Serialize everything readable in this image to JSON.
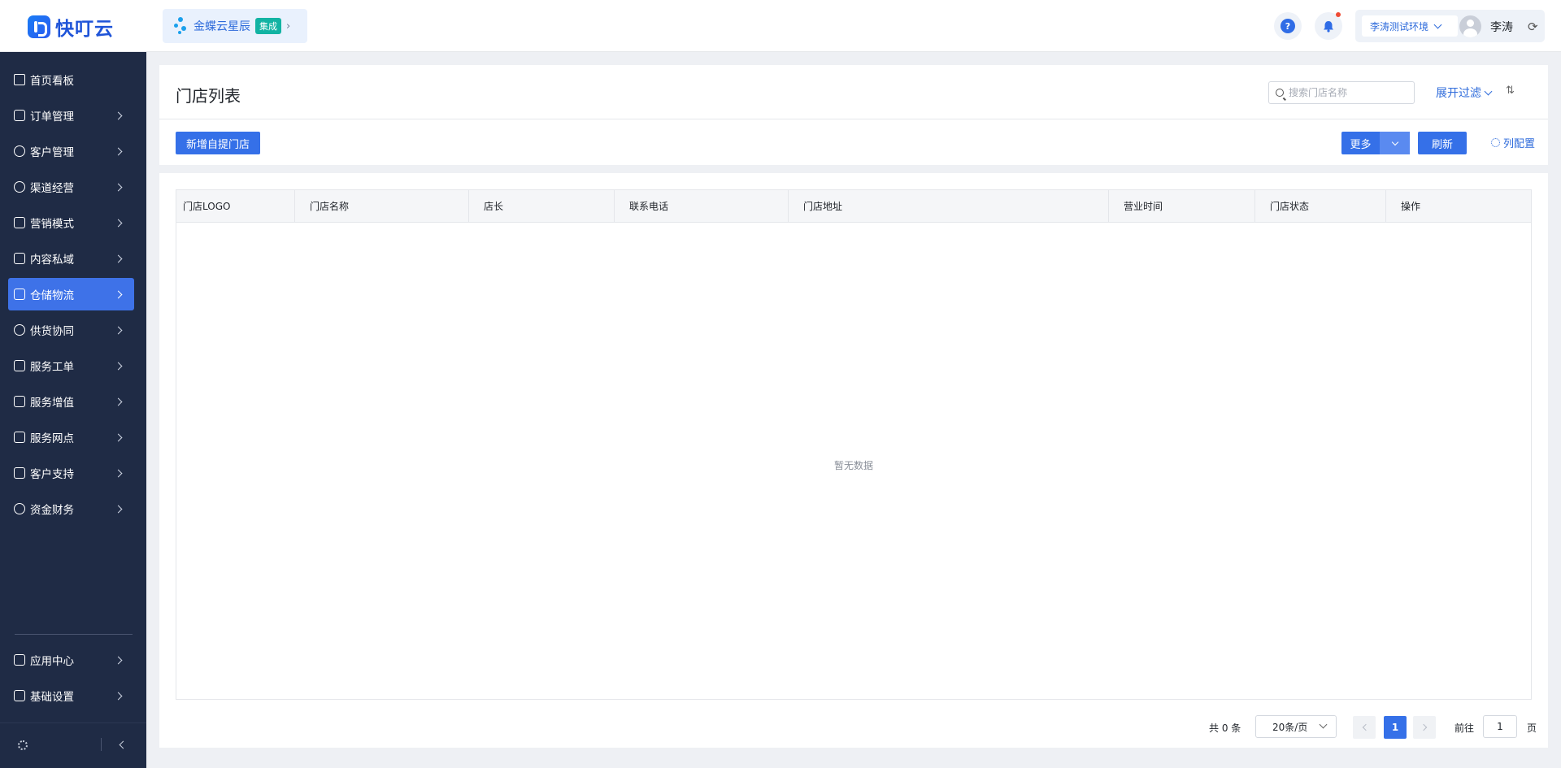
{
  "app": {
    "name": "快叮云"
  },
  "integration": {
    "name": "金蝶云星辰",
    "tag": "集成"
  },
  "header": {
    "help_icon": "question-circle-icon",
    "notification_icon": "bell-icon",
    "environment": "李涛测试环境",
    "user_name": "李涛",
    "colors": {
      "accent": "#3570e8",
      "badge": "#ef4b34"
    }
  },
  "sidebar": {
    "items": [
      {
        "label": "首页看板",
        "icon": "home-icon"
      },
      {
        "label": "订单管理",
        "icon": "order-icon"
      },
      {
        "label": "客户管理",
        "icon": "user-icon"
      },
      {
        "label": "渠道经营",
        "icon": "channel-icon"
      },
      {
        "label": "营销模式",
        "icon": "tag-icon"
      },
      {
        "label": "内容私域",
        "icon": "image-icon"
      },
      {
        "label": "仓储物流",
        "icon": "warehouse-icon",
        "active": true
      },
      {
        "label": "供货协同",
        "icon": "supplier-icon"
      },
      {
        "label": "服务工单",
        "icon": "ticket-icon"
      },
      {
        "label": "服务增值",
        "icon": "bag-icon"
      },
      {
        "label": "服务网点",
        "icon": "store-icon"
      },
      {
        "label": "客户支持",
        "icon": "support-icon"
      },
      {
        "label": "资金财务",
        "icon": "yuan-icon"
      }
    ],
    "bottom_items": [
      {
        "label": "应用中心",
        "icon": "cube-icon"
      },
      {
        "label": "基础设置",
        "icon": "settings-icon"
      }
    ],
    "colors": {
      "background": "#1f2b45",
      "active": "#3e72e8"
    }
  },
  "page": {
    "title": "门店列表",
    "search_placeholder": "搜索门店名称",
    "filter_label": "展开过滤",
    "sort_icon": "sort-icon",
    "add_button": "新增自提门店",
    "more_button": "更多",
    "refresh_button": "刷新",
    "column_config": "列配置"
  },
  "table": {
    "columns": [
      "门店LOGO",
      "门店名称",
      "店长",
      "联系电话",
      "门店地址",
      "营业时间",
      "门店状态",
      "操作"
    ],
    "rows": [],
    "empty_text": "暂无数据"
  },
  "pagination": {
    "total_text": "共 0 条",
    "page_size": "20条/页",
    "current_page": "1",
    "goto_label": "前往",
    "goto_value": "1",
    "goto_suffix": "页"
  }
}
